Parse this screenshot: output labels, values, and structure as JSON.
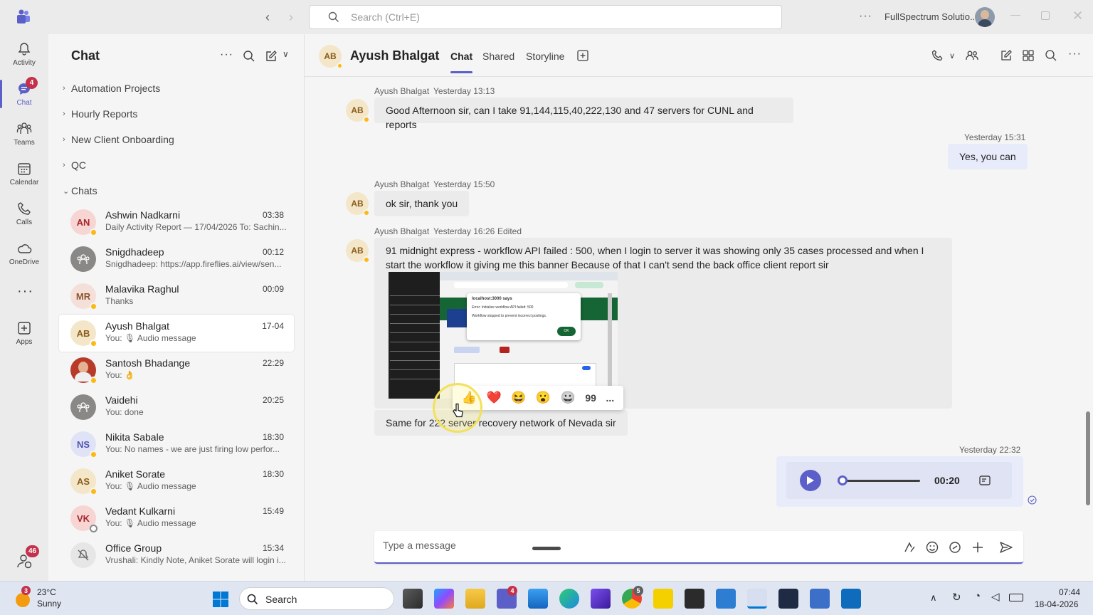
{
  "titlebar": {
    "search_placeholder": "Search (Ctrl+E)",
    "org_name": "FullSpectrum Solutio..."
  },
  "rail": {
    "items": [
      {
        "label": "Activity",
        "icon": "bell-icon"
      },
      {
        "label": "Chat",
        "icon": "chat-icon",
        "badge": "4"
      },
      {
        "label": "Teams",
        "icon": "teams-icon"
      },
      {
        "label": "Calendar",
        "icon": "calendar-icon"
      },
      {
        "label": "Calls",
        "icon": "phone-icon"
      },
      {
        "label": "OneDrive",
        "icon": "cloud-icon"
      },
      {
        "label": "Apps",
        "icon": "apps-icon"
      }
    ],
    "help_badge": "46"
  },
  "leftpane": {
    "title": "Chat",
    "folders": [
      {
        "label": "Automation Projects",
        "chevron": "›"
      },
      {
        "label": "Hourly Reports",
        "chevron": "›"
      },
      {
        "label": "New Client Onboarding",
        "chevron": "›"
      },
      {
        "label": "QC",
        "chevron": "›"
      },
      {
        "label": "Chats",
        "chevron": "⌄"
      }
    ],
    "chats": [
      {
        "initials": "AN",
        "name": "Ashwin Nadkarni",
        "time": "03:38",
        "preview": "Daily Activity Report — 17/04/2026 To: Sachin..."
      },
      {
        "initials": "",
        "name": "Snigdhadeep",
        "time": "00:12",
        "preview": "Snigdhadeep: https://app.fireflies.ai/view/sen..."
      },
      {
        "initials": "MR",
        "name": "Malavika Raghul",
        "time": "00:09",
        "preview": "Thanks"
      },
      {
        "initials": "AB",
        "name": "Ayush Bhalgat",
        "time": "17-04",
        "preview": "You: 🎙 Audio message"
      },
      {
        "initials": "",
        "name": "Santosh Bhadange",
        "time": "22:29",
        "preview": "You: 👌"
      },
      {
        "initials": "",
        "name": "Vaidehi",
        "time": "20:25",
        "preview": "You: done"
      },
      {
        "initials": "NS",
        "name": "Nikita Sabale",
        "time": "18:30",
        "preview": "You: No names - we are just firing low perfor..."
      },
      {
        "initials": "AS",
        "name": "Aniket Sorate",
        "time": "18:30",
        "preview": "You: 🎙 Audio message"
      },
      {
        "initials": "VK",
        "name": "Vedant Kulkarni",
        "time": "15:49",
        "preview": "You: 🎙 Audio message"
      },
      {
        "initials": "",
        "name": "Office Group",
        "time": "15:34",
        "preview": "Vrushali: Kindly Note, Aniket Sorate will login i..."
      }
    ]
  },
  "chat": {
    "header": {
      "initials": "AB",
      "name": "Ayush Bhalgat",
      "tabs": [
        "Chat",
        "Shared",
        "Storyline"
      ]
    },
    "messages": [
      {
        "author": "Ayush Bhalgat",
        "time": "Yesterday 13:13",
        "text": "Good Afternoon sir, can I take 91,144,115,40,222,130 and 47 servers for CUNL and reports"
      },
      {
        "author": "",
        "time": "Yesterday 15:31",
        "text": "Yes, you can"
      },
      {
        "author": "Ayush Bhalgat",
        "time": "Yesterday 15:50",
        "text": "ok sir, thank you"
      },
      {
        "author": "Ayush Bhalgat",
        "time": "Yesterday 16:26",
        "edited": "Edited",
        "text": "91 midnight express - workflow API failed : 500, when I login to server it was showing only 35 cases processed and when I start the workflow it giving me this banner Because of that I can't send the back office client report sir"
      },
      {
        "author": "",
        "time": "",
        "text": "Same for 222 server recovery network of Nevada sir"
      },
      {
        "author": "",
        "time": "Yesterday 22:32",
        "text": ""
      }
    ],
    "screenshot": {
      "dialog_title": "localhost:3000 says",
      "dialog_line1": "Error: Initialize workflow API failed: 500",
      "dialog_line2": "Workflow stopped to prevent incorrect postings.",
      "ok_label": "OK"
    },
    "reactions": [
      "👍",
      "❤️",
      "😆",
      "😮",
      "😀",
      "99",
      "..."
    ],
    "audio": {
      "duration": "00:20",
      "progress": 0
    },
    "composer_placeholder": "Type a message"
  },
  "taskbar": {
    "weather_temp": "23°C",
    "weather_desc": "Sunny",
    "weather_badge": "3",
    "search_label": "Search",
    "teams_badge": "4",
    "chrome_badge": "5",
    "time": "07:44",
    "date": "18-04-2026"
  },
  "colors": {
    "accent": "#5b5fc7",
    "badge": "#c4314b",
    "away": "#fdb913"
  }
}
